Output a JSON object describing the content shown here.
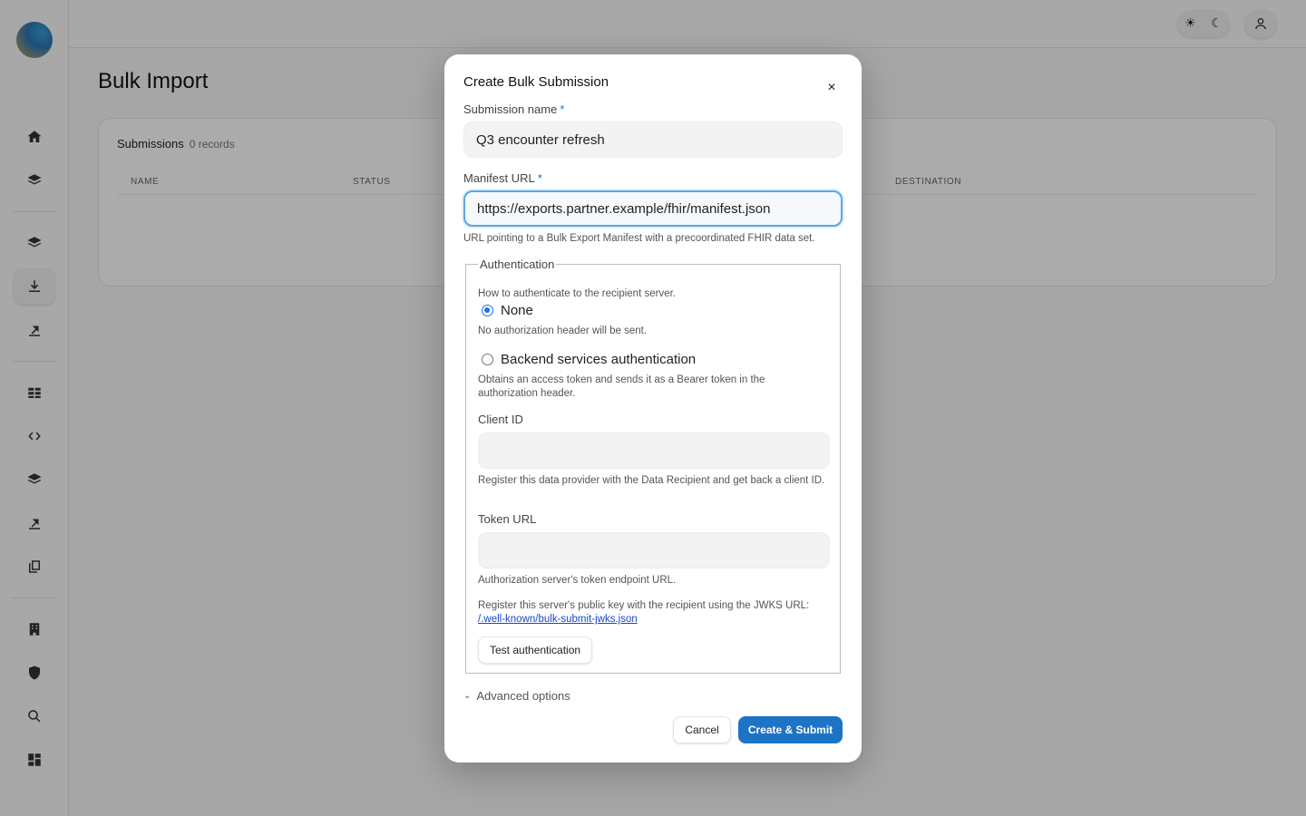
{
  "page": {
    "title": "Bulk Import"
  },
  "topbar": {
    "theme_light_icon": "sun-icon",
    "theme_dark_icon": "moon-icon",
    "user_icon": "user-icon"
  },
  "sidebar": {
    "items": [
      {
        "name": "home",
        "icon": "home-icon"
      },
      {
        "name": "layers-1",
        "icon": "layers-icon"
      },
      {
        "name": "layers-2",
        "icon": "layers-icon"
      },
      {
        "name": "bulk-import",
        "icon": "download-icon",
        "active": true
      },
      {
        "name": "export-1",
        "icon": "export-icon"
      },
      {
        "name": "table",
        "icon": "table-icon"
      },
      {
        "name": "code",
        "icon": "code-icon"
      },
      {
        "name": "layers-3",
        "icon": "layers-icon"
      },
      {
        "name": "export-2",
        "icon": "export-icon"
      },
      {
        "name": "copy",
        "icon": "copy-icon"
      },
      {
        "name": "building",
        "icon": "building-icon"
      },
      {
        "name": "shield",
        "icon": "shield-icon"
      },
      {
        "name": "search",
        "icon": "search-icon"
      },
      {
        "name": "dashboard",
        "icon": "dashboard-icon"
      }
    ]
  },
  "submissions": {
    "title": "Submissions",
    "count": "0 records",
    "columns": [
      "NAME",
      "STATUS",
      "DESTINATION"
    ]
  },
  "modal": {
    "title": "Create Bulk Submission",
    "close_symbol": "×",
    "submission_name_label": "Submission name",
    "required_mark": "*",
    "submission_name_value": "Q3 encounter refresh",
    "manifest_url_label": "Manifest URL",
    "manifest_url_value": "https://exports.partner.example/fhir/manifest.json",
    "manifest_url_help": "URL pointing to a Bulk Export Manifest with a precoordinated FHIR data set.",
    "auth": {
      "legend": "Authentication",
      "description": "How to authenticate to the recipient server.",
      "option_none_label": "None",
      "option_none_help": "No authorization header will be sent.",
      "option_backend_label": "Backend services authentication",
      "option_backend_help": "Obtains an access token and sends it as a Bearer token in the authorization header.",
      "selected": "None",
      "client_id_label": "Client ID",
      "client_id_value": "",
      "client_id_help": "Register this data provider with the Data Recipient and get back a client ID.",
      "token_url_label": "Token URL",
      "token_url_value": "",
      "token_url_help": "Authorization server's token endpoint URL.",
      "jwks_text": "Register this server's public key with the recipient using the JWKS URL:",
      "jwks_link": "/.well-known/bulk-submit-jwks.json",
      "test_button": "Test authentication"
    },
    "advanced_label": "Advanced options",
    "cancel_button": "Cancel",
    "submit_button": "Create & Submit"
  }
}
